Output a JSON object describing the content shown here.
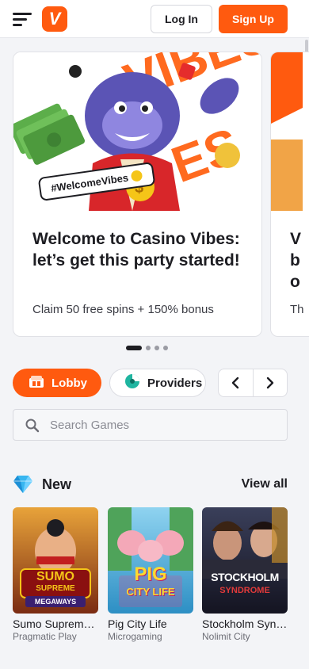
{
  "theme": {
    "accent": "#ff5a0f",
    "background": "#f3f4f7",
    "text": "#1d1d22"
  },
  "header": {
    "menu_icon": "hamburger-icon",
    "logo_letter": "V",
    "login_label": "Log In",
    "signup_label": "Sign Up"
  },
  "promos": [
    {
      "badge": "#WelcomeVibes",
      "title": "Welcome to Casino Vibes: let’s get this party started!",
      "subtitle": "Claim 50 free spins + 150% bonus"
    },
    {
      "title": "V b o",
      "subtitle": "Th"
    }
  ],
  "carousel": {
    "slide_count": 4,
    "active_index": 0
  },
  "categories": {
    "lobby_label": "Lobby",
    "providers_label": "Providers",
    "prev_icon": "chevron-left-icon",
    "next_icon": "chevron-right-icon"
  },
  "search": {
    "placeholder": "Search Games",
    "value": ""
  },
  "new_section": {
    "title": "New",
    "view_all_label": "View all",
    "games": [
      {
        "name": "Sumo Supreme Megaways",
        "provider": "Pragmatic Play",
        "thumb_text_1": "SUMO",
        "thumb_text_2": "SUPREME",
        "thumb_text_3": "MEGAWAYS"
      },
      {
        "name": "Pig City Life",
        "provider": "Microgaming",
        "thumb_text_1": "PIG",
        "thumb_text_2": "CITY LIFE"
      },
      {
        "name": "Stockholm Syndrome",
        "provider": "Nolimit City",
        "thumb_text_1": "STOCKHOLM",
        "thumb_text_2": "SYNDROME"
      }
    ]
  }
}
